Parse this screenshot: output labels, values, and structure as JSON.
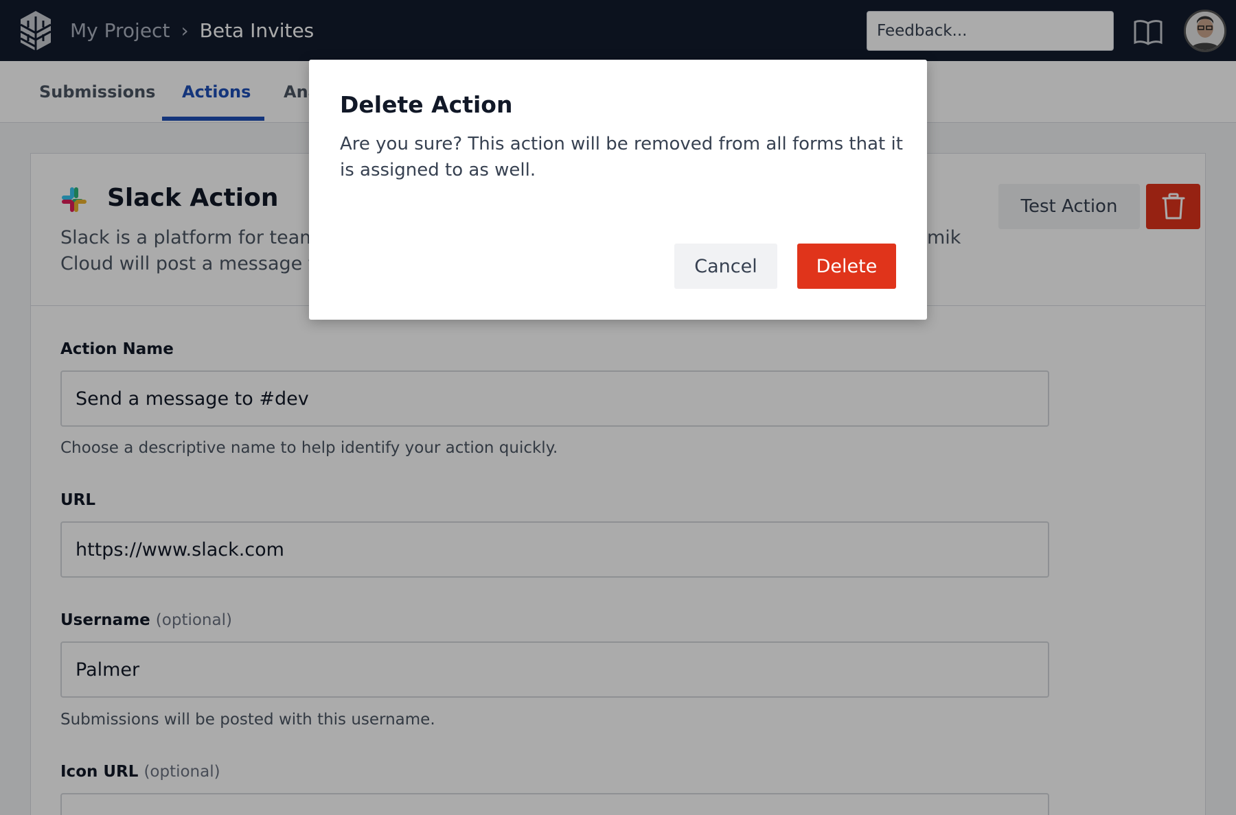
{
  "header": {
    "breadcrumb_project": "My Project",
    "breadcrumb_current": "Beta Invites",
    "feedback_placeholder": "Feedback...",
    "logo_icon": "bricks-logo-icon",
    "docs_icon": "book-icon",
    "avatar_icon": "user-avatar"
  },
  "tabs": [
    {
      "label": "Submissions",
      "active": false
    },
    {
      "label": "Actions",
      "active": true
    },
    {
      "label": "Ana",
      "active": false
    }
  ],
  "action_card": {
    "icon": "slack-icon",
    "title": "Slack Action",
    "description_line1": "Slack is a platform for team",
    "description_line2": "Cloud will post a message f",
    "description_tail": "mik",
    "test_button": "Test Action",
    "trash_icon": "trash-icon"
  },
  "fields": {
    "action_name": {
      "label": "Action Name",
      "value": "Send a message to #dev",
      "help": "Choose a descriptive name to help identify your action quickly."
    },
    "url": {
      "label": "URL",
      "value": "https://www.slack.com"
    },
    "username": {
      "label": "Username",
      "optional": "(optional)",
      "value": "Palmer",
      "help": "Submissions will be posted with this username."
    },
    "icon_url": {
      "label": "Icon URL",
      "optional": "(optional)",
      "value": ""
    }
  },
  "modal": {
    "title": "Delete Action",
    "body": "Are you sure? This action will be removed from all forms that it is assigned to as well.",
    "cancel": "Cancel",
    "delete": "Delete"
  },
  "colors": {
    "topbar": "#121b2e",
    "accent": "#1e4fb8",
    "danger": "#e0341b"
  }
}
